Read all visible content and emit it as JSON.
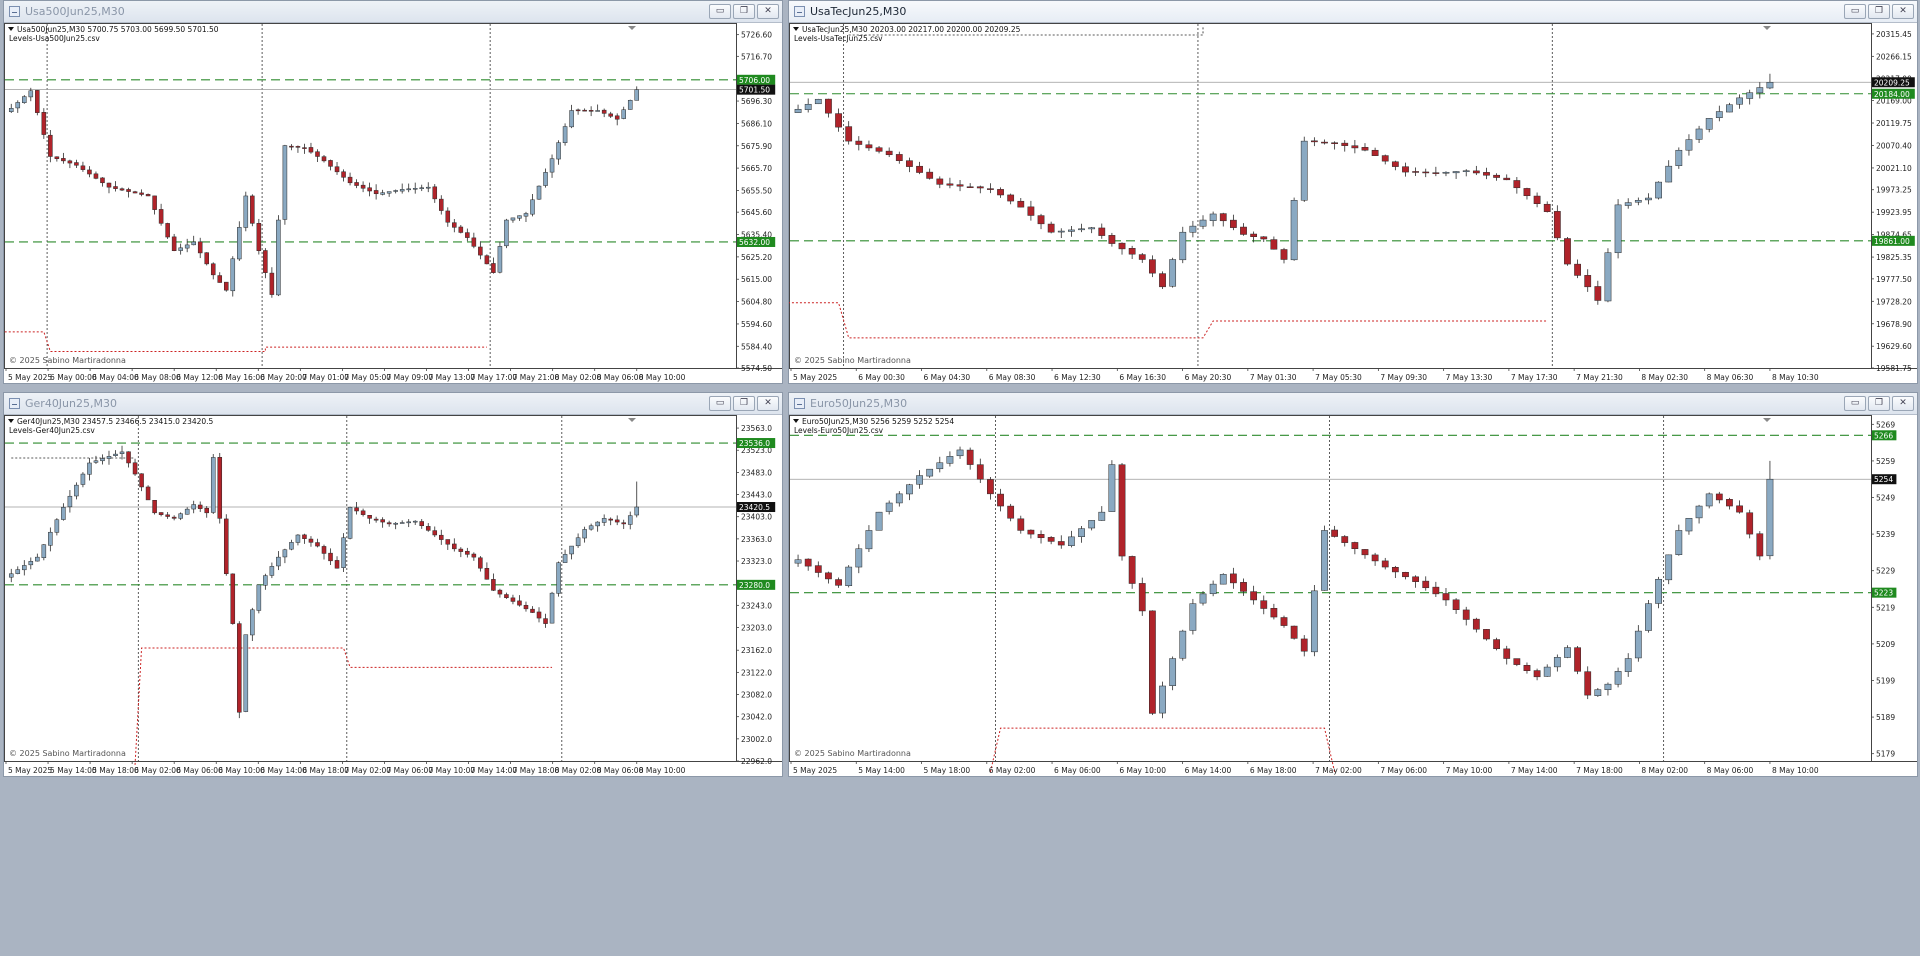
{
  "colors": {
    "bull": "#8aa9c2",
    "bear": "#b0232a",
    "wick": "#2a2a2a",
    "level_green": "#2e8b2e",
    "price_line": "#9a9a9a",
    "vline": "#333333",
    "red_dots": "#cc2222",
    "tag_price_bg": "#111111",
    "tag_level_bg": "#1f8a1f"
  },
  "windows": [
    {
      "id": "usa500",
      "title": "Usa500Jun25,M30",
      "active": false,
      "header_line1": "Usa500Jun25,M30  5700.75 5703.00 5699.50 5701.50",
      "header_line2": "Levels-Usa500Jun25.csv",
      "copyright": "© 2025 Sabino Martiradonna",
      "buttons": {
        "minimize": "▭",
        "restore": "❐",
        "close": "✕"
      },
      "chart_data": {
        "type": "candlestick",
        "ylim": [
          5574.5,
          5731
        ],
        "y_ticks": [
          "5726.60",
          "5716.70",
          "5706.00",
          "5696.30",
          "5686.10",
          "5675.90",
          "5665.70",
          "5655.50",
          "5645.60",
          "5635.40",
          "5625.20",
          "5615.00",
          "5604.80",
          "5594.60",
          "5584.40",
          "5574.50"
        ],
        "x_labels": [
          "5 May 2025",
          "6 May 00:00",
          "6 May 04:00",
          "6 May 08:00",
          "6 May 12:00",
          "6 May 16:00",
          "6 May 20:00",
          "7 May 01:00",
          "7 May 05:00",
          "7 May 09:00",
          "7 May 13:00",
          "7 May 17:00",
          "7 May 21:00",
          "8 May 02:00",
          "8 May 06:00",
          "8 May 10:00"
        ],
        "current_price": 5701.5,
        "current_price_label": "5701.50",
        "levels": [
          {
            "value": 5706.0,
            "label": "5706.00"
          },
          {
            "value": 5632.0,
            "label": "5632.00"
          }
        ],
        "day_separators": [
          6,
          39,
          74
        ],
        "red_step": [
          [
            -1,
            5591
          ],
          [
            5,
            5591
          ],
          [
            6,
            5582
          ],
          [
            39,
            5582
          ],
          [
            39,
            5584
          ],
          [
            73,
            5584
          ]
        ],
        "last_extra_high": 5703,
        "anchors": [
          [
            0,
            5693
          ],
          [
            3,
            5701
          ],
          [
            6,
            5671
          ],
          [
            10,
            5667
          ],
          [
            15,
            5657
          ],
          [
            21,
            5653
          ],
          [
            25,
            5628
          ],
          [
            28,
            5632
          ],
          [
            31,
            5617
          ],
          [
            33,
            5610
          ],
          [
            36,
            5653
          ],
          [
            38,
            5628
          ],
          [
            40,
            5608
          ],
          [
            42,
            5676
          ],
          [
            45,
            5675
          ],
          [
            48,
            5669
          ],
          [
            52,
            5659
          ],
          [
            56,
            5654
          ],
          [
            60,
            5656
          ],
          [
            64,
            5657
          ],
          [
            67,
            5641
          ],
          [
            70,
            5634
          ],
          [
            72,
            5626
          ],
          [
            74,
            5618
          ],
          [
            76,
            5642
          ],
          [
            79,
            5645
          ],
          [
            83,
            5670
          ],
          [
            86,
            5692
          ],
          [
            90,
            5692
          ],
          [
            93,
            5688
          ],
          [
            96,
            5701
          ]
        ]
      }
    },
    {
      "id": "usatec",
      "title": "UsaTecJun25,M30",
      "active": true,
      "header_line1": "UsaTecJun25,M30  20203.00 20217.00 20200.00 20209.25",
      "header_line2": "Levels-UsaTecJun25.csv",
      "copyright": "© 2025 Sabino Martiradonna",
      "buttons": {
        "minimize": "▭",
        "restore": "❐",
        "close": "✕"
      },
      "chart_data": {
        "type": "candlestick",
        "ylim": [
          19581.75,
          20335
        ],
        "y_ticks": [
          "20315.45",
          "20266.15",
          "20217.00",
          "20169.00",
          "20119.75",
          "20070.40",
          "20021.10",
          "19973.25",
          "19923.95",
          "19874.65",
          "19825.35",
          "19777.50",
          "19728.20",
          "19678.90",
          "19629.60",
          "19581.75"
        ],
        "x_labels": [
          "5 May 2025",
          "6 May 00:30",
          "6 May 04:30",
          "6 May 08:30",
          "6 May 12:30",
          "6 May 16:30",
          "6 May 20:30",
          "7 May 01:30",
          "7 May 05:30",
          "7 May 09:30",
          "7 May 13:30",
          "7 May 17:30",
          "7 May 21:30",
          "8 May 02:30",
          "8 May 06:30",
          "8 May 10:30"
        ],
        "current_price": 20209.25,
        "current_price_label": "20209.25",
        "levels": [
          {
            "value": 20184.0,
            "label": "20184.00"
          },
          {
            "value": 19861.0,
            "label": "19861.00"
          }
        ],
        "day_separators": [
          5,
          40,
          75
        ],
        "red_step": [
          [
            -1,
            19725
          ],
          [
            4,
            19725
          ],
          [
            5,
            19648
          ],
          [
            40,
            19648
          ],
          [
            41,
            19685
          ],
          [
            74,
            19685
          ]
        ],
        "top_bracket": [
          5,
          40
        ],
        "last_extra_high": 20228,
        "anchors": [
          [
            0,
            20150
          ],
          [
            2,
            20172
          ],
          [
            5,
            20080
          ],
          [
            9,
            20050
          ],
          [
            14,
            19985
          ],
          [
            19,
            19975
          ],
          [
            22,
            19935
          ],
          [
            25,
            19880
          ],
          [
            29,
            19890
          ],
          [
            31,
            19855
          ],
          [
            34,
            19820
          ],
          [
            36,
            19760
          ],
          [
            38,
            19880
          ],
          [
            41,
            19920
          ],
          [
            44,
            19875
          ],
          [
            46,
            19865
          ],
          [
            48,
            19820
          ],
          [
            50,
            20080
          ],
          [
            53,
            20075
          ],
          [
            56,
            20060
          ],
          [
            60,
            20012
          ],
          [
            63,
            20010
          ],
          [
            66,
            20015
          ],
          [
            70,
            19995
          ],
          [
            74,
            19925
          ],
          [
            76,
            19810
          ],
          [
            78,
            19760
          ],
          [
            79,
            19730
          ],
          [
            81,
            19940
          ],
          [
            84,
            19955
          ],
          [
            87,
            20060
          ],
          [
            90,
            20130
          ],
          [
            93,
            20175
          ],
          [
            96,
            20209
          ]
        ]
      }
    },
    {
      "id": "ger40",
      "title": "Ger40Jun25,M30",
      "active": false,
      "header_line1": "Ger40Jun25,M30  23457.5 23466.5 23415.0 23420.5",
      "header_line2": "Levels-Ger40Jun25.csv",
      "copyright": "© 2025 Sabino Martiradonna",
      "buttons": {
        "minimize": "▭",
        "restore": "❐",
        "close": "✕"
      },
      "chart_data": {
        "type": "candlestick",
        "ylim": [
          22962.0,
          23583
        ],
        "y_ticks": [
          "23563.0",
          "23523.0",
          "23483.0",
          "23443.0",
          "23403.0",
          "23363.0",
          "23323.0",
          "23283.0",
          "23243.0",
          "23203.0",
          "23162.0",
          "23122.0",
          "23082.0",
          "23042.0",
          "23002.0",
          "22962.0"
        ],
        "x_labels": [
          "5 May 2025",
          "5 May 14:00",
          "5 May 18:00",
          "6 May 02:00",
          "6 May 06:00",
          "6 May 10:00",
          "6 May 14:00",
          "6 May 18:00",
          "7 May 02:00",
          "7 May 06:00",
          "7 May 10:00",
          "7 May 14:00",
          "7 May 18:00",
          "8 May 02:00",
          "8 May 06:00",
          "8 May 10:00"
        ],
        "current_price": 23420.5,
        "current_price_label": "23420.5",
        "levels": [
          {
            "value": 23536.0,
            "label": "23536.0"
          },
          {
            "value": 23280.0,
            "label": "23280.0"
          }
        ],
        "day_separators": [
          20,
          52,
          85
        ],
        "red_step": [
          [
            19,
            22955
          ],
          [
            20,
            23166
          ],
          [
            51,
            23166
          ],
          [
            52,
            23131
          ],
          [
            83,
            23131
          ]
        ],
        "top_bracket_left": [
          0,
          19,
          23509
        ],
        "last_extra_high": 23466.5,
        "anchors": [
          [
            0,
            23300
          ],
          [
            4,
            23330
          ],
          [
            8,
            23420
          ],
          [
            12,
            23500
          ],
          [
            17,
            23520
          ],
          [
            19,
            23480
          ],
          [
            22,
            23410
          ],
          [
            25,
            23400
          ],
          [
            28,
            23425
          ],
          [
            30,
            23410
          ],
          [
            31,
            23510
          ],
          [
            32,
            23400
          ],
          [
            33,
            23300
          ],
          [
            34,
            23210
          ],
          [
            35,
            23050
          ],
          [
            36,
            23190
          ],
          [
            38,
            23280
          ],
          [
            41,
            23330
          ],
          [
            44,
            23370
          ],
          [
            47,
            23350
          ],
          [
            50,
            23310
          ],
          [
            52,
            23420
          ],
          [
            55,
            23400
          ],
          [
            58,
            23390
          ],
          [
            62,
            23395
          ],
          [
            65,
            23370
          ],
          [
            68,
            23345
          ],
          [
            71,
            23330
          ],
          [
            74,
            23270
          ],
          [
            77,
            23250
          ],
          [
            80,
            23230
          ],
          [
            82,
            23210
          ],
          [
            84,
            23320
          ],
          [
            88,
            23380
          ],
          [
            91,
            23400
          ],
          [
            94,
            23390
          ],
          [
            96,
            23420
          ]
        ]
      }
    },
    {
      "id": "euro50",
      "title": "Euro50Jun25,M30",
      "active": false,
      "header_line1": "Euro50Jun25,M30  5256 5259 5252 5254",
      "header_line2": "Levels-Euro50Jun25.csv",
      "copyright": "© 2025 Sabino Martiradonna",
      "buttons": {
        "minimize": "▭",
        "restore": "❐",
        "close": "✕"
      },
      "chart_data": {
        "type": "candlestick",
        "ylim": [
          5177,
          5271
        ],
        "y_ticks": [
          "5269",
          "5259",
          "5249",
          "5239",
          "5229",
          "5219",
          "5209",
          "5199",
          "5189",
          "5179"
        ],
        "x_labels": [
          "5 May 2025",
          "5 May 14:00",
          "5 May 18:00",
          "6 May 02:00",
          "6 May 06:00",
          "6 May 10:00",
          "6 May 14:00",
          "6 May 18:00",
          "7 May 02:00",
          "7 May 06:00",
          "7 May 10:00",
          "7 May 14:00",
          "7 May 18:00",
          "8 May 02:00",
          "8 May 06:00",
          "8 May 10:00"
        ],
        "current_price": 5254,
        "current_price_label": "5254",
        "levels": [
          {
            "value": 5266,
            "label": "5266"
          },
          {
            "value": 5223,
            "label": "5223"
          }
        ],
        "day_separators": [
          20,
          53,
          86
        ],
        "red_step": [
          [
            19,
            5174
          ],
          [
            20,
            5186
          ],
          [
            52,
            5186
          ],
          [
            53,
            5174
          ]
        ],
        "last_extra_high": 5259,
        "anchors": [
          [
            0,
            5232
          ],
          [
            4,
            5225
          ],
          [
            8,
            5245
          ],
          [
            12,
            5255
          ],
          [
            16,
            5262
          ],
          [
            19,
            5250
          ],
          [
            22,
            5240
          ],
          [
            26,
            5236
          ],
          [
            30,
            5245
          ],
          [
            31,
            5258
          ],
          [
            32,
            5233
          ],
          [
            34,
            5218
          ],
          [
            35,
            5190
          ],
          [
            37,
            5205
          ],
          [
            39,
            5220
          ],
          [
            42,
            5228
          ],
          [
            45,
            5221
          ],
          [
            48,
            5214
          ],
          [
            50,
            5207
          ],
          [
            52,
            5240
          ],
          [
            55,
            5235
          ],
          [
            58,
            5230
          ],
          [
            61,
            5226
          ],
          [
            64,
            5221
          ],
          [
            67,
            5213
          ],
          [
            70,
            5205
          ],
          [
            73,
            5200
          ],
          [
            76,
            5208
          ],
          [
            78,
            5195
          ],
          [
            80,
            5198
          ],
          [
            82,
            5205
          ],
          [
            84,
            5220
          ],
          [
            87,
            5240
          ],
          [
            90,
            5250
          ],
          [
            93,
            5245
          ],
          [
            95,
            5233
          ],
          [
            97,
            5254
          ]
        ]
      }
    }
  ]
}
